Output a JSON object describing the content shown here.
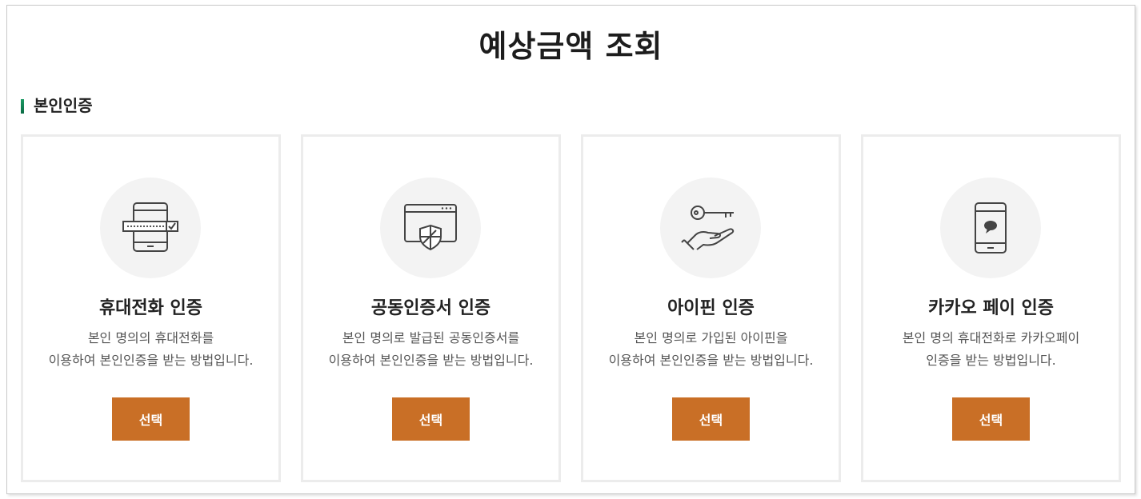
{
  "page": {
    "title": "예상금액 조회"
  },
  "section": {
    "title": "본인인증"
  },
  "colors": {
    "accent_bar": "#138a57",
    "button": "#c96f26",
    "card_border": "#ececec",
    "icon_bg": "#f3f3f3"
  },
  "cards": [
    {
      "icon": "mobile-phone-password-icon",
      "title": "휴대전화 인증",
      "desc_line1": "본인 명의의 휴대전화를",
      "desc_line2": "이용하여 본인인증을 받는 방법입니다.",
      "button_label": "선택"
    },
    {
      "icon": "browser-shield-icon",
      "title": "공동인증서 인증",
      "desc_line1": "본인 명의로 발급된 공동인증서를",
      "desc_line2": "이용하여 본인인증을 받는 방법입니다.",
      "button_label": "선택"
    },
    {
      "icon": "hand-key-icon",
      "title": "아이핀 인증",
      "desc_line1": "본인 명의로 가입된 아이핀을",
      "desc_line2": "이용하여 본인인증을 받는 방법입니다.",
      "button_label": "선택"
    },
    {
      "icon": "mobile-chat-icon",
      "title": "카카오 페이 인증",
      "desc_line1": "본인 명의 휴대전화로 카카오페이",
      "desc_line2": "인증을 받는 방법입니다.",
      "button_label": "선택"
    }
  ]
}
